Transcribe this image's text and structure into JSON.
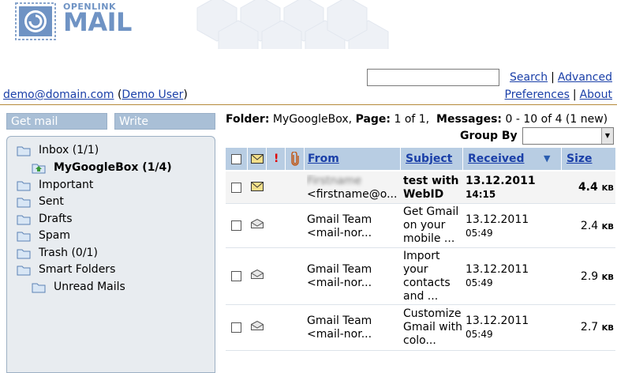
{
  "brand": {
    "line1": "OPENLINK",
    "line2": "MAIL"
  },
  "search": {
    "value": "",
    "search_link": "Search",
    "advanced_link": "Advanced"
  },
  "user": {
    "email": "demo@domain.com",
    "name": "Demo User"
  },
  "links": {
    "preferences": "Preferences",
    "about": "About"
  },
  "buttons": {
    "get_mail": "Get mail",
    "write": "Write"
  },
  "folders": [
    {
      "label": "Inbox (1/1)"
    },
    {
      "label": "MyGoogleBox (1/4)"
    },
    {
      "label": "Important"
    },
    {
      "label": "Sent"
    },
    {
      "label": "Drafts"
    },
    {
      "label": "Spam"
    },
    {
      "label": "Trash (0/1)"
    },
    {
      "label": "Smart Folders"
    },
    {
      "label": "Unread Mails"
    }
  ],
  "folder_info": {
    "folder_label": "Folder:",
    "folder": "MyGoogleBox,",
    "page_label": "Page:",
    "page": "1 of 1,",
    "messages_label": "Messages:",
    "messages": "0 - 10 of 4 (1 new)"
  },
  "group_by": {
    "label": "Group By",
    "value": ""
  },
  "table": {
    "headers": {
      "from": "From",
      "subject": "Subject",
      "received": "Received",
      "size": "Size"
    },
    "rows": [
      {
        "from1": "Firstname",
        "from2": "<firstname@o...",
        "subject": "test with WebID",
        "date": "13.12.2011",
        "time": "14:15",
        "size": "4.4",
        "unit": "KB"
      },
      {
        "from1": "Gmail Team",
        "from2": "<mail-nor...",
        "subject": "Get Gmail on your mobile ...",
        "date": "13.12.2011",
        "time": "05:49",
        "size": "2.4",
        "unit": "KB"
      },
      {
        "from1": "Gmail Team",
        "from2": "<mail-nor...",
        "subject": "Import your contacts and ...",
        "date": "13.12.2011",
        "time": "05:49",
        "size": "2.9",
        "unit": "KB"
      },
      {
        "from1": "Gmail Team",
        "from2": "<mail-nor...",
        "subject": "Customize Gmail with colo...",
        "date": "13.12.2011",
        "time": "05:49",
        "size": "2.7",
        "unit": "KB"
      }
    ]
  },
  "colors": {
    "accent": "#1a3fa8",
    "header_bg": "#b8cde3",
    "button_bg": "#a9bfd6",
    "panel_bg": "#e8ecf0",
    "rule": "#b58a3a"
  }
}
